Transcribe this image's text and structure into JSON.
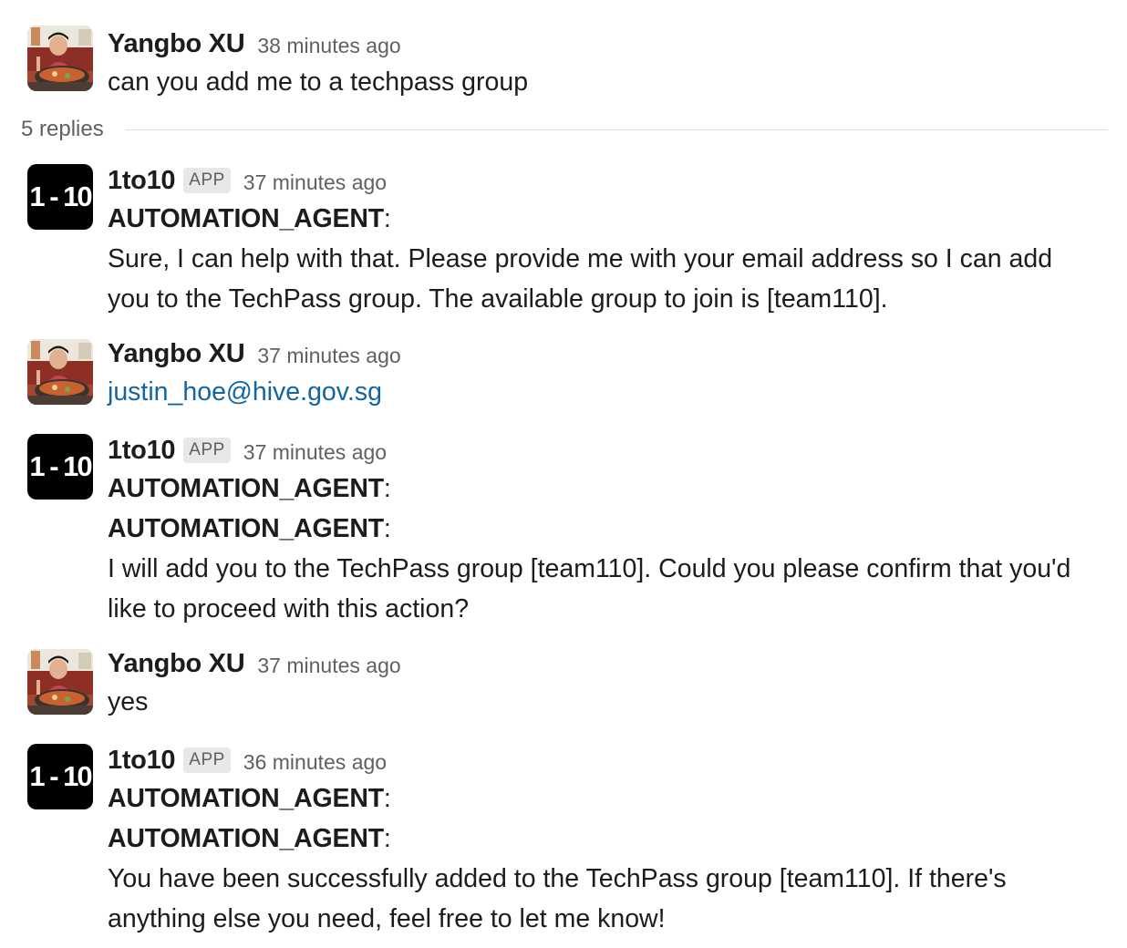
{
  "parent": {
    "sender": "Yangbo XU",
    "time": "38 minutes ago",
    "text": "can you add me to a techpass group"
  },
  "replies_label": "5 replies",
  "replies": [
    {
      "sender": "1to10",
      "badge": "APP",
      "avatar_text": "1 - 10",
      "time": "37 minutes ago",
      "agent_lines": [
        "AUTOMATION_AGENT"
      ],
      "text_lines": [
        "Sure, I can help with that. Please provide me with your email address so I can add",
        "you to the TechPass group. The available group to join is [team110]."
      ]
    },
    {
      "sender": "Yangbo XU",
      "time": "37 minutes ago",
      "link": "justin_hoe@hive.gov.sg"
    },
    {
      "sender": "1to10",
      "badge": "APP",
      "avatar_text": "1 - 10",
      "time": "37 minutes ago",
      "agent_lines": [
        "AUTOMATION_AGENT",
        "AUTOMATION_AGENT"
      ],
      "text_lines": [
        "I will add you to the TechPass group [team110]. Could you please confirm that you'd",
        "like to proceed with this action?"
      ]
    },
    {
      "sender": "Yangbo XU",
      "time": "37 minutes ago",
      "text": "yes"
    },
    {
      "sender": "1to10",
      "badge": "APP",
      "avatar_text": "1 - 10",
      "time": "36 minutes ago",
      "agent_lines": [
        "AUTOMATION_AGENT",
        "AUTOMATION_AGENT"
      ],
      "text_lines": [
        "You have been successfully added to the TechPass group [team110]. If there's",
        "anything else you need, feel free to let me know!"
      ]
    }
  ],
  "colors": {
    "link": "#1264a3",
    "muted": "#616061",
    "text": "#1d1c1d",
    "app_avatar_bg": "#000000"
  }
}
